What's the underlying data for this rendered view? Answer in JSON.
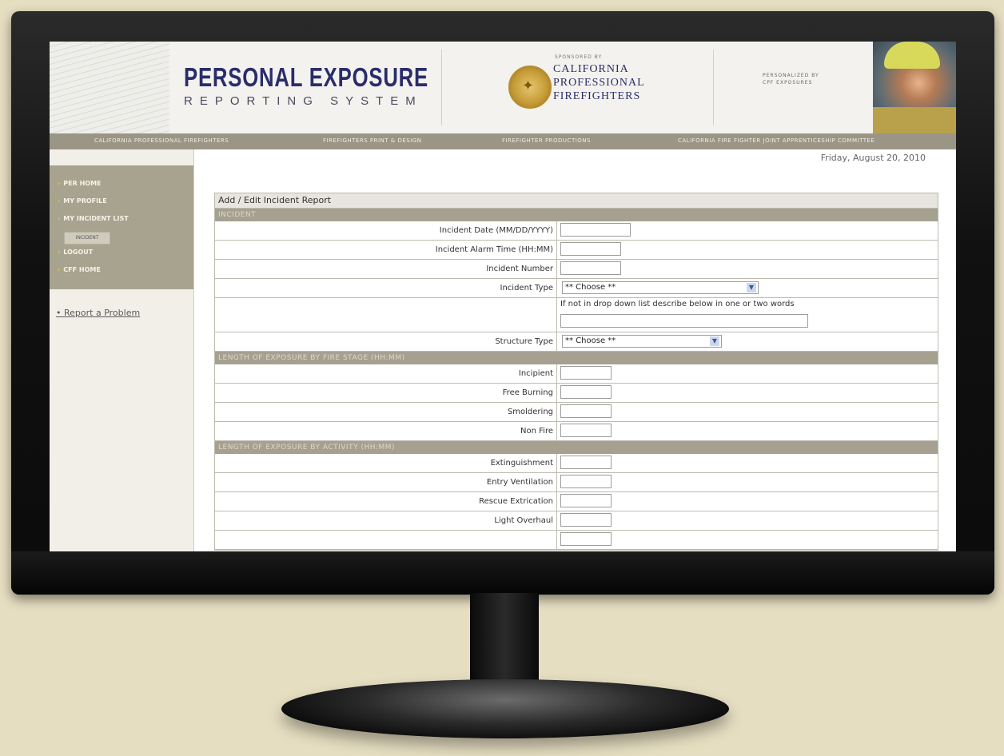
{
  "header": {
    "title": "PERSONAL EXPOSURE",
    "subtitle": "REPORTING SYSTEM",
    "sponsored_by": "SPONSORED BY",
    "sponsor_line1": "CALIFORNIA",
    "sponsor_line2": "PROFESSIONAL",
    "sponsor_line3": "FIREFIGHTERS",
    "powered_line1": "PERSONALIZED BY",
    "powered_line2": "CPF EXPOSURES"
  },
  "nav": {
    "items": [
      "CALIFORNIA PROFESSIONAL FIREFIGHTERS",
      "FIREFIGHTERS PRINT & DESIGN",
      "FIREFIGHTER PRODUCTIONS",
      "CALIFORNIA FIRE FIGHTER JOINT APPRENTICESHIP COMMITTEE"
    ]
  },
  "sidebar": {
    "items": [
      "PER HOME",
      "MY PROFILE",
      "MY INCIDENT LIST",
      "LOGOUT",
      "CFF HOME"
    ],
    "sub_button": "INCIDENT",
    "report_link": "Report a Problem"
  },
  "date": "Friday, August 20, 2010",
  "form": {
    "title": "Add / Edit Incident Report",
    "sections": {
      "incident": "INCIDENT",
      "fire_stage": "LENGTH OF EXPOSURE BY FIRE STAGE (HH:MM)",
      "activity": "LENGTH OF EXPOSURE BY ACTIVITY (HH:MM)"
    },
    "incident_date_label": "Incident Date (MM/DD/YYYY)",
    "alarm_time_label": "Incident Alarm Time (HH:MM)",
    "incident_number_label": "Incident Number",
    "incident_type_label": "Incident Type",
    "incident_type_value": "** Choose **",
    "other_hint": "If not in drop down list describe below in one or two words",
    "structure_type_label": "Structure Type",
    "structure_type_value": "** Choose **",
    "fire_stage_rows": [
      "Incipient",
      "Free Burning",
      "Smoldering",
      "Non Fire"
    ],
    "activity_rows": [
      "Extinguishment",
      "Entry Ventilation",
      "Rescue Extrication",
      "Light Overhaul"
    ]
  }
}
